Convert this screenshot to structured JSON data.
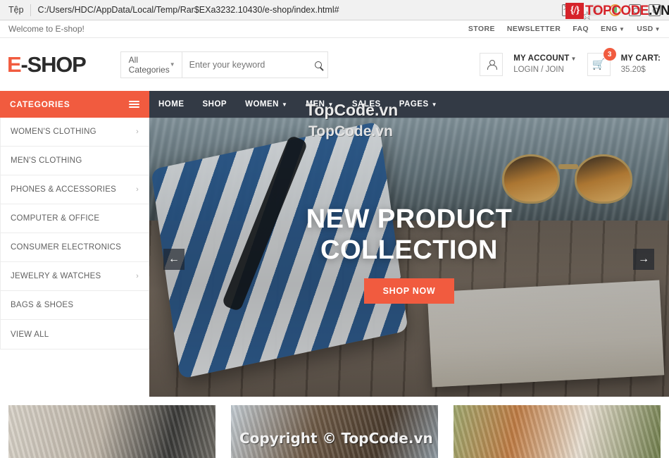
{
  "browser": {
    "menu_label": "Tệp",
    "url": "C:/Users/HDC/AppData/Local/Temp/Rar$EXa3232.10430/e-shop/index.html#",
    "icons": [
      "translate-icon",
      "bookmark-star-icon",
      "download-icon",
      "extension-icon",
      "camera-icon",
      "screenshot-icon"
    ]
  },
  "watermark": {
    "brand_mark": "{/}",
    "brand_top": "TOPCODE",
    "brand_top_suffix": ".VN",
    "nav_overlay": "TopCode.vn",
    "hero_overlay": "TopCode.vn",
    "copyright": "Copyright © TopCode.vn"
  },
  "topbar": {
    "welcome": "Welcome to E-shop!",
    "links": [
      {
        "label": "STORE",
        "caret": false
      },
      {
        "label": "NEWSLETTER",
        "caret": false
      },
      {
        "label": "FAQ",
        "caret": false
      },
      {
        "label": "ENG",
        "caret": true
      },
      {
        "label": "USD",
        "caret": true
      }
    ]
  },
  "header": {
    "logo_first": "E",
    "logo_rest": "-SHOP",
    "search": {
      "category_label": "All Categories",
      "placeholder": "Enter your keyword",
      "value": ""
    },
    "account": {
      "title": "MY ACCOUNT",
      "caret": "▾",
      "subtitle": "LOGIN / JOIN"
    },
    "cart": {
      "badge_count": "3",
      "title": "MY CART:",
      "total": "35.20$"
    }
  },
  "categories": {
    "title": "CATEGORIES",
    "items": [
      {
        "label": "WOMEN'S CLOTHING",
        "has_submenu": true
      },
      {
        "label": "MEN'S CLOTHING",
        "has_submenu": false
      },
      {
        "label": "PHONES & ACCESSORIES",
        "has_submenu": true
      },
      {
        "label": "COMPUTER & OFFICE",
        "has_submenu": false
      },
      {
        "label": "CONSUMER ELECTRONICS",
        "has_submenu": false
      },
      {
        "label": "JEWELRY & WATCHES",
        "has_submenu": true
      },
      {
        "label": "BAGS & SHOES",
        "has_submenu": false
      },
      {
        "label": "VIEW ALL",
        "has_submenu": false
      }
    ]
  },
  "nav": {
    "items": [
      {
        "label": "HOME",
        "caret": false
      },
      {
        "label": "SHOP",
        "caret": false
      },
      {
        "label": "WOMEN",
        "caret": true
      },
      {
        "label": "MEN",
        "caret": true
      },
      {
        "label": "SALES",
        "caret": false
      },
      {
        "label": "PAGES",
        "caret": true
      }
    ]
  },
  "hero": {
    "title_line1": "NEW PRODUCT",
    "title_line2": "COLLECTION",
    "cta_label": "SHOP NOW",
    "prev_arrow": "←",
    "next_arrow": "→"
  },
  "products": [
    {
      "name": "knit-sweater-tile"
    },
    {
      "name": "denim-outfit-tile"
    },
    {
      "name": "leather-bag-tile"
    }
  ],
  "colors": {
    "accent": "#f15b3f",
    "nav_dark": "#333a45",
    "brand_red": "#d6232a"
  }
}
